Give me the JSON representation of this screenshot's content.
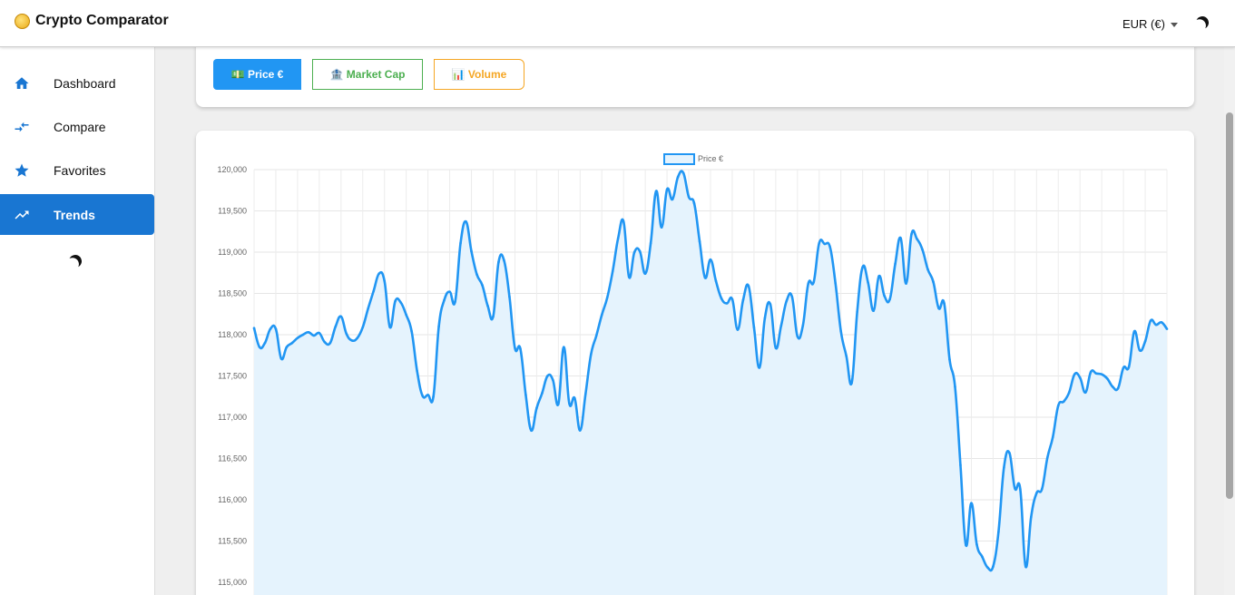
{
  "app": {
    "title": "Crypto Comparator",
    "logo_icon": "coin-icon"
  },
  "header": {
    "currency_label": "EUR (€)",
    "theme_toggle_icon": "moon-icon"
  },
  "sidebar": {
    "items": [
      {
        "label": "Dashboard",
        "icon": "home-icon",
        "active": false
      },
      {
        "label": "Compare",
        "icon": "compare-arrows-icon",
        "active": false
      },
      {
        "label": "Favorites",
        "icon": "star-icon",
        "active": false
      },
      {
        "label": "Trends",
        "icon": "trending-up-icon",
        "active": true
      }
    ],
    "theme_toggle_icon": "moon-icon"
  },
  "toolbar": {
    "price_label": "💵 Price €",
    "market_cap_label": "🏦 Market Cap",
    "volume_label": "📊 Volume",
    "price_color": "#2196f3",
    "market_cap_color": "#4caf50",
    "volume_color": "#f5a623"
  },
  "colors": {
    "accent": "#1976d2",
    "series_line": "#2196f3",
    "series_fill": "#e5f3fd"
  },
  "chart_data": {
    "type": "area",
    "legend": {
      "position": "top-center",
      "entries": [
        "Price €"
      ]
    },
    "series": [
      {
        "name": "Price €",
        "values": [
          118080,
          117850,
          117900,
          118070,
          118070,
          117710,
          117850,
          117900,
          117960,
          118000,
          118030,
          117990,
          118020,
          117910,
          117900,
          118100,
          118220,
          118010,
          117930,
          117960,
          118090,
          118320,
          118530,
          118740,
          118650,
          118090,
          118410,
          118390,
          118240,
          118040,
          117560,
          117260,
          117270,
          117250,
          118100,
          118420,
          118520,
          118400,
          119110,
          119370,
          119010,
          118730,
          118600,
          118350,
          118220,
          118880,
          118900,
          118460,
          117840,
          117830,
          117270,
          116840,
          117110,
          117290,
          117500,
          117450,
          117160,
          117850,
          117170,
          117230,
          116840,
          117280,
          117760,
          117990,
          118240,
          118450,
          118770,
          119170,
          119370,
          118700,
          119000,
          119010,
          118740,
          119110,
          119740,
          119300,
          119760,
          119640,
          119910,
          119960,
          119670,
          119590,
          119130,
          118690,
          118910,
          118650,
          118440,
          118380,
          118430,
          118060,
          118420,
          118590,
          118090,
          117600,
          118200,
          118370,
          117840,
          118110,
          118410,
          118460,
          117980,
          118110,
          118620,
          118640,
          119110,
          119100,
          119060,
          118620,
          118040,
          117740,
          117420,
          118280,
          118820,
          118630,
          118290,
          118710,
          118470,
          118430,
          118860,
          119170,
          118620,
          119220,
          119160,
          119030,
          118790,
          118640,
          118320,
          118380,
          117700,
          117370,
          116420,
          115450,
          115960,
          115460,
          115310,
          115180,
          115190,
          115610,
          116390,
          116570,
          116140,
          116130,
          115190,
          115790,
          116080,
          116130,
          116510,
          116760,
          117140,
          117190,
          117300,
          117520,
          117480,
          117300,
          117550,
          117530,
          117520,
          117470,
          117370,
          117350,
          117600,
          117610,
          118040,
          117810,
          117920,
          118170,
          118120,
          118150,
          118070
        ]
      }
    ],
    "ylim": [
      115000,
      120000
    ],
    "yticks": [
      "115,000",
      "115,500",
      "116,000",
      "116,500",
      "117,000",
      "117,500",
      "118,000",
      "118,500",
      "119,000",
      "119,500",
      "120,000"
    ],
    "grid": true
  }
}
